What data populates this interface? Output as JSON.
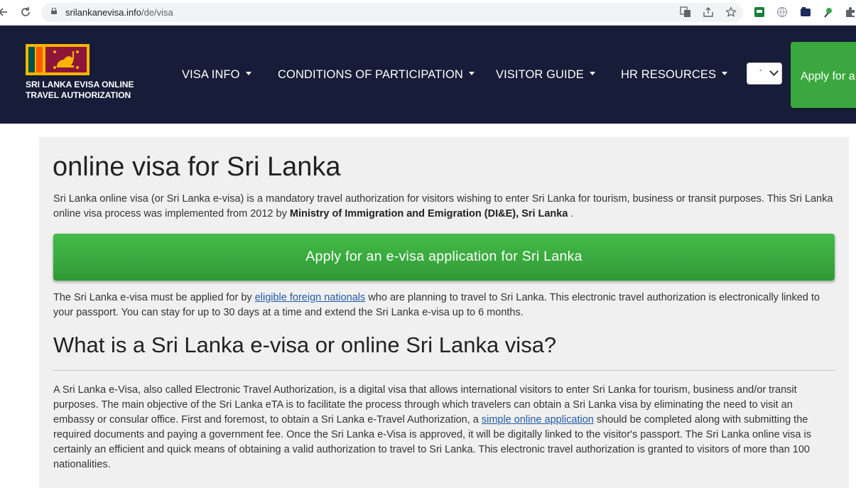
{
  "browser": {
    "url_host": "srilankanevisa.info",
    "url_path": "/de/visa"
  },
  "header": {
    "brand_line1": "SRI LANKA EVISA ONLINE",
    "brand_line2": "TRAVEL AUTHORIZATION",
    "menu": [
      {
        "label": "VISA INFO"
      },
      {
        "label": "CONDITIONS OF PARTICIPATION"
      },
      {
        "label": "VISITOR GUIDE"
      },
      {
        "label": "HR RESOURCES"
      }
    ],
    "language_value": "-",
    "apply_label": "Apply for a visa online"
  },
  "main": {
    "title": "online visa for Sri Lanka",
    "intro_text": "Sri Lanka online visa (or Sri Lanka e-visa) is a mandatory travel authorization for visitors wishing to enter Sri Lanka for tourism, business or transit purposes. This Sri Lanka online visa process was implemented from 2012 by ",
    "intro_bold": "Ministry of Immigration and Emigration (DI&E), Sri Lanka",
    "intro_end": " .",
    "apply_button": "Apply for an e-visa application for Sri Lanka",
    "para2_start": "The Sri Lanka e-visa must be applied for by ",
    "para2_link": "eligible foreign nationals",
    "para2_end": " who are planning to travel to Sri Lanka. This electronic travel authorization is electronically linked to your passport. You can stay for up to 30 days at a time and extend the Sri Lanka e-visa up to 6 months.",
    "heading2": "What is a Sri Lanka e-visa or online Sri Lanka visa?",
    "para3_start": "A Sri Lanka e-Visa, also called Electronic Travel Authorization, is a digital visa that allows international visitors to enter Sri Lanka for tourism, business and/or transit purposes. The main objective of the Sri Lanka eTA is to facilitate the process through which travelers can obtain a Sri Lanka visa by eliminating the need to visit an embassy or consular office. First and foremost, to obtain a Sri Lanka e-Travel Authorization, a ",
    "para3_link": "simple online application",
    "para3_end": " should be completed along with submitting the required documents and paying a government fee. Once the Sri Lanka e-Visa is approved, it will be digitally linked to the visitor's passport. The Sri Lanka online visa is certainly an efficient and quick means of obtaining a valid authorization to travel to Sri Lanka. This electronic travel authorization is granted to visitors of more than 100 nationalities."
  },
  "colors": {
    "header_bg": "#171d38",
    "accent_green": "#3aa83e",
    "link": "#1f5ba6",
    "card_bg": "#f0f0f0"
  },
  "icons": [
    "back-arrow-icon",
    "reload-icon",
    "lock-icon",
    "translate-icon",
    "share-icon",
    "star-icon",
    "extension-icons",
    "sri-lanka-flag"
  ]
}
